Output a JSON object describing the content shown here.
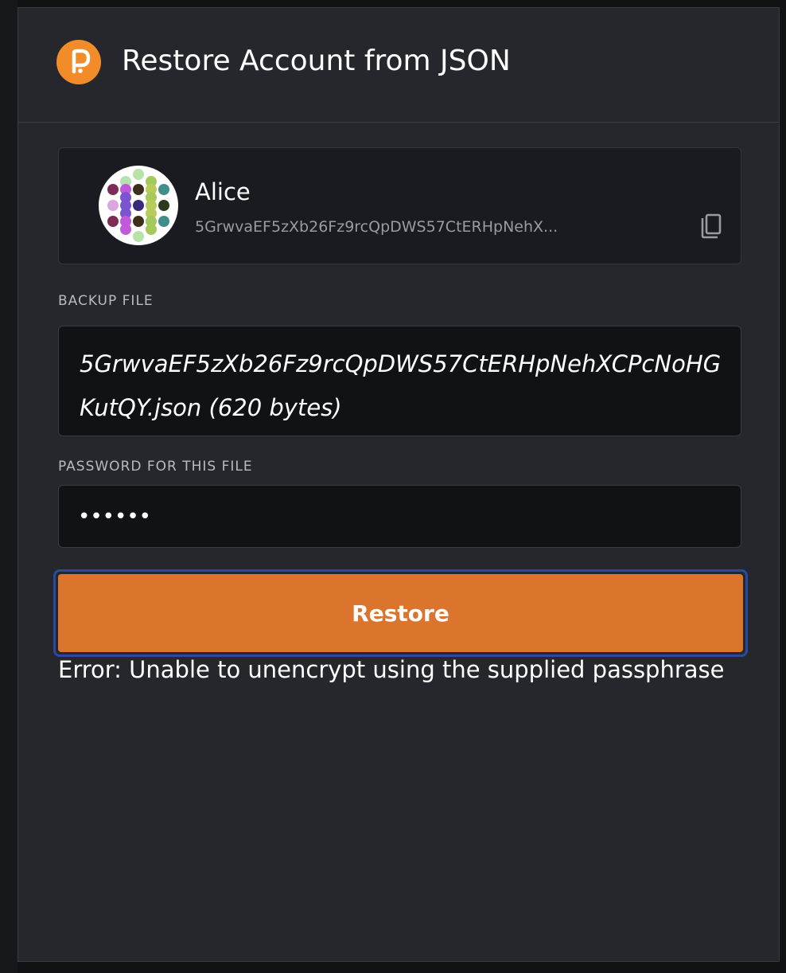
{
  "header": {
    "title": "Restore Account from JSON",
    "logo_icon": "polkadot-logo-icon",
    "brand_color": "#F28C28"
  },
  "account": {
    "name": "Alice",
    "address": "5GrwvaEF5zXb26Fz9rcQpDWS57CtERHpNehX...",
    "identicon": "identicon-icon",
    "copy_icon": "copy-icon"
  },
  "form": {
    "backup_label": "BACKUP FILE",
    "backup_file": "5GrwvaEF5zXb26Fz9rcQpDWS57CtERHpNehXCPcNoHGKutQY.json (620 bytes)",
    "password_label": "PASSWORD FOR THIS FILE",
    "password_value": "••••••",
    "restore_label": "Restore",
    "accent_color": "#DB742C"
  },
  "error": {
    "message": "Error: Unable to unencrypt using the supplied passphrase"
  }
}
